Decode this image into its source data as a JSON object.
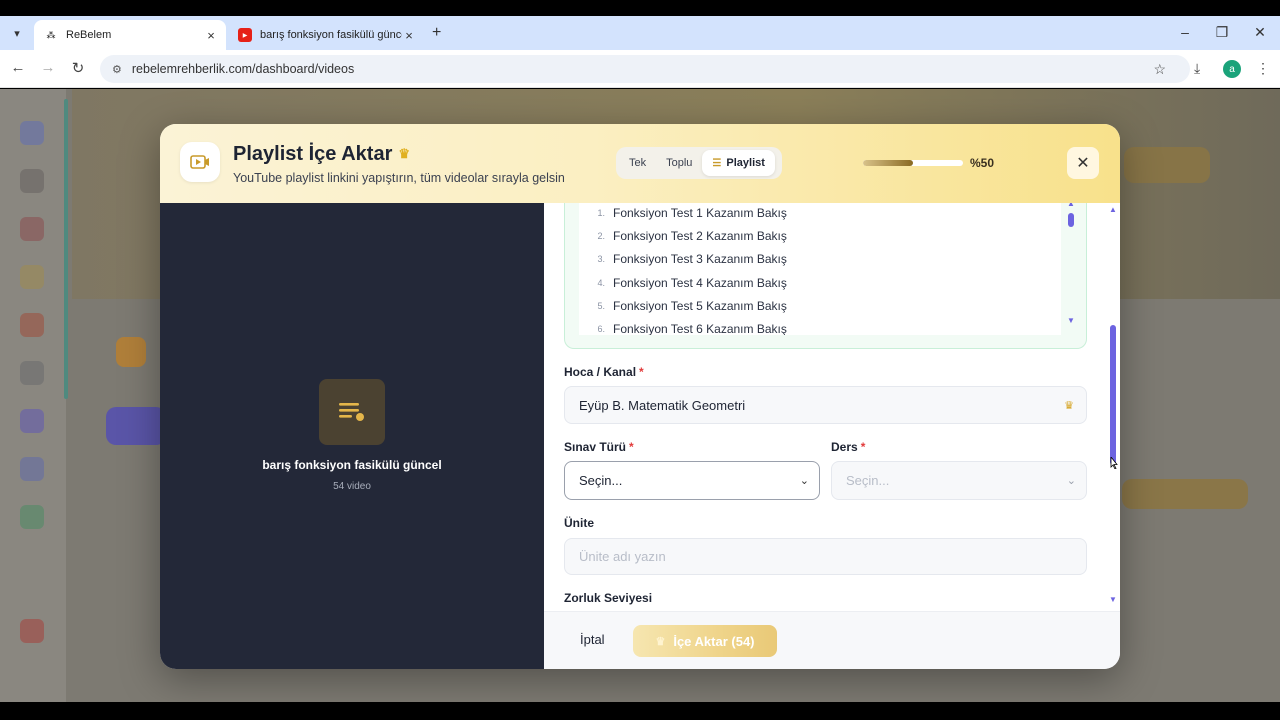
{
  "browser": {
    "tabs": [
      {
        "title": "ReBelem",
        "active": true
      },
      {
        "title": "barış fonksiyon fasikülü güncel",
        "active": false
      }
    ],
    "url": "rebelemrehberlik.com/dashboard/videos",
    "profile_initial": "a"
  },
  "modal": {
    "title": "Playlist İçe Aktar",
    "subtitle": "YouTube playlist linkini yapıştırın, tüm videolar sırayla gelsin",
    "modes": [
      "Tek",
      "Toplu",
      "Playlist"
    ],
    "active_mode": "Playlist",
    "progress_percent": 50,
    "progress_label": "%50",
    "playlist": {
      "name": "barış fonksiyon fasikülü güncel",
      "count_label": "54 video"
    },
    "videos": [
      {
        "num": "1.",
        "title": "Fonksiyon Test 1 Kazanım Bakış"
      },
      {
        "num": "2.",
        "title": "Fonksiyon Test 2 Kazanım Bakış"
      },
      {
        "num": "3.",
        "title": "Fonksiyon Test 3 Kazanım Bakış"
      },
      {
        "num": "4.",
        "title": "Fonksiyon Test 4 Kazanım Bakış"
      },
      {
        "num": "5.",
        "title": "Fonksiyon Test 5 Kazanım Bakış"
      },
      {
        "num": "6.",
        "title": "Fonksiyon Test 6 Kazanım Bakış"
      }
    ],
    "form": {
      "teacher_label": "Hoca / Kanal",
      "teacher_value": "Eyüp B. Matematik Geometri",
      "exam_type_label": "Sınav Türü",
      "exam_type_value": "Seçin...",
      "lesson_label": "Ders",
      "lesson_value": "Seçin...",
      "unit_label": "Ünite",
      "unit_placeholder": "Ünite adı yazın",
      "difficulty_label": "Zorluk Seviyesi",
      "required_mark": "*"
    },
    "footer": {
      "cancel_label": "İptal",
      "import_label": "İçe Aktar (54)"
    }
  }
}
